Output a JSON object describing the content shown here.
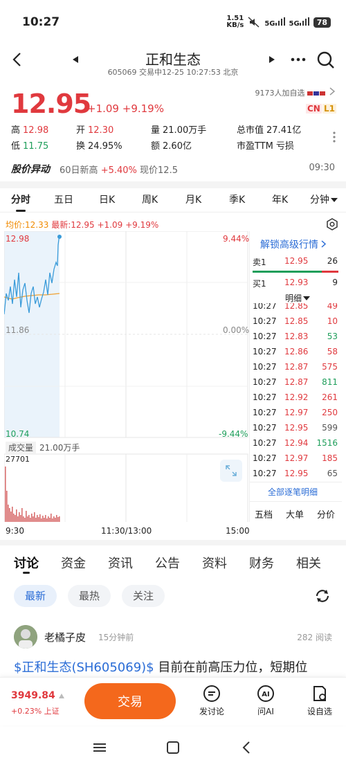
{
  "status_bar": {
    "time": "10:27",
    "net_speed": "1.51",
    "net_unit": "KB/s",
    "sig1": "5G",
    "sig2": "5G",
    "battery": "78"
  },
  "header": {
    "title": "正和生态",
    "subtitle": "605069 交易中12-25 10:27:53 北京"
  },
  "quote": {
    "price": "12.95",
    "change": "+1.09",
    "change_pct": "+9.19%",
    "followers": "9173人加自选",
    "tag_cn": "CN",
    "tag_l1": "L1",
    "stats": [
      {
        "label": "高",
        "value": "12.98",
        "color": "red"
      },
      {
        "label": "开",
        "value": "12.30",
        "color": "red"
      },
      {
        "label": "量",
        "value": "21.00万手",
        "color": "black"
      },
      {
        "label": "总市值",
        "value": "27.41亿",
        "color": "black"
      },
      {
        "label": "低",
        "value": "11.75",
        "color": "green"
      },
      {
        "label": "换",
        "value": "24.95%",
        "color": "black"
      },
      {
        "label": "额",
        "value": "2.60亿",
        "color": "black"
      },
      {
        "label": "市盈TTM",
        "value": "亏损",
        "color": "black"
      }
    ]
  },
  "alert": {
    "label": "股价异动",
    "text_prefix": "60日新高",
    "text_highlight": "+5.40%",
    "text_suffix": "现价12.5",
    "time": "09:30"
  },
  "chart_tabs": [
    "分时",
    "五日",
    "日K",
    "周K",
    "月K",
    "季K",
    "年K",
    "分钟"
  ],
  "chart": {
    "avg_label": "均价:12.33",
    "latest_label": "最新:12.95",
    "latest_chg": "+1.09",
    "latest_pct": "+9.19%",
    "y_high": "12.98",
    "y_mid": "11.86",
    "y_low": "10.74",
    "pct_high": "9.44%",
    "pct_mid": "0.00%",
    "pct_low": "-9.44%",
    "volume_label": "成交量",
    "volume_value": "21.00万手",
    "vol_max": "27701",
    "time_start": "9:30",
    "time_mid": "11:30/13:00",
    "time_end": "15:00"
  },
  "order_book": {
    "unlock": "解锁高级行情",
    "sell1": {
      "label": "卖1",
      "price": "12.95",
      "vol": "26"
    },
    "buy1": {
      "label": "买1",
      "price": "12.93",
      "vol": "9"
    },
    "detail": "明细",
    "ticks": [
      {
        "t": "10:27",
        "p": "12.85",
        "v": "49",
        "pc": "red",
        "vc": "red"
      },
      {
        "t": "10:27",
        "p": "12.85",
        "v": "10",
        "pc": "red",
        "vc": "red"
      },
      {
        "t": "10:27",
        "p": "12.83",
        "v": "53",
        "pc": "red",
        "vc": "green"
      },
      {
        "t": "10:27",
        "p": "12.86",
        "v": "58",
        "pc": "red",
        "vc": "red"
      },
      {
        "t": "10:27",
        "p": "12.87",
        "v": "575",
        "pc": "red",
        "vc": "red"
      },
      {
        "t": "10:27",
        "p": "12.87",
        "v": "811",
        "pc": "red",
        "vc": "green"
      },
      {
        "t": "10:27",
        "p": "12.92",
        "v": "261",
        "pc": "red",
        "vc": "red"
      },
      {
        "t": "10:27",
        "p": "12.97",
        "v": "250",
        "pc": "red",
        "vc": "red"
      },
      {
        "t": "10:27",
        "p": "12.95",
        "v": "599",
        "pc": "red",
        "vc": "gray"
      },
      {
        "t": "10:27",
        "p": "12.94",
        "v": "1516",
        "pc": "red",
        "vc": "green"
      },
      {
        "t": "10:27",
        "p": "12.97",
        "v": "185",
        "pc": "red",
        "vc": "red"
      },
      {
        "t": "10:27",
        "p": "12.95",
        "v": "65",
        "pc": "red",
        "vc": "gray"
      }
    ],
    "all_ticks": "全部逐笔明细",
    "tabs": [
      "五档",
      "大单",
      "分价"
    ]
  },
  "news_tabs": [
    "讨论",
    "资金",
    "资讯",
    "公告",
    "资料",
    "财务",
    "相关"
  ],
  "filters": [
    "最新",
    "最热",
    "关注"
  ],
  "post": {
    "user": "老橘子皮",
    "time": "15分钟前",
    "reads": "282 阅读",
    "link": "$正和生态(SH605069)$",
    "text": " 目前在前高压力位，短期位"
  },
  "bottom": {
    "index_value": "3949.84",
    "index_chg": "+0.23% 上证",
    "trade": "交易",
    "discuss": "发讨论",
    "ai": "问AI",
    "watch": "设自选"
  },
  "colors": {
    "up": "#e0393e",
    "down": "#1e9e5a",
    "accent": "#2a6cd6",
    "trade": "#f4681c"
  }
}
